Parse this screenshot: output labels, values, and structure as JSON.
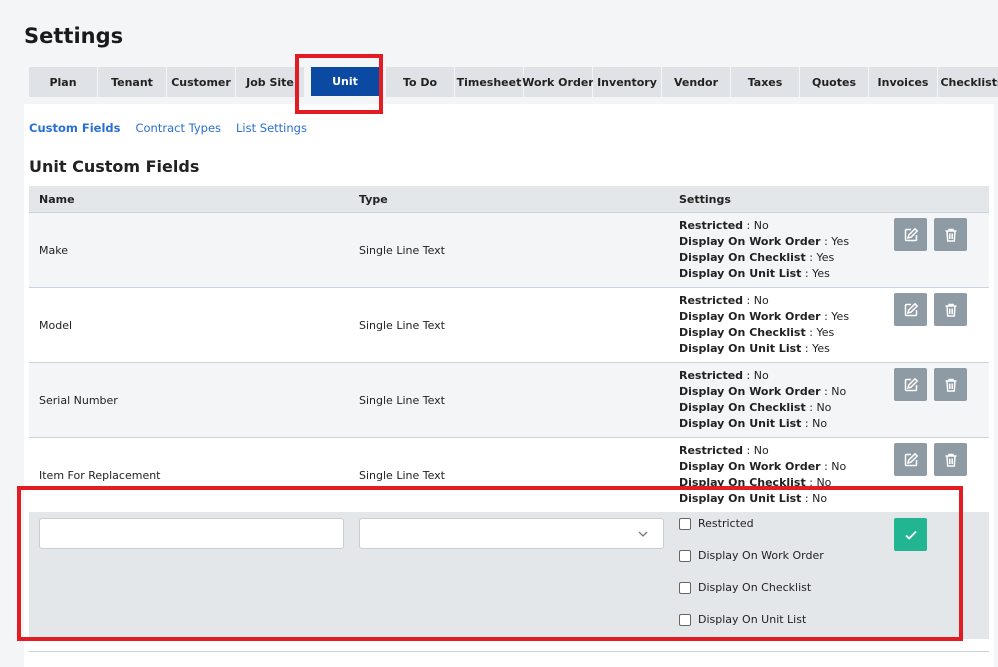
{
  "page": {
    "title": "Settings"
  },
  "tabs": [
    {
      "label": "Plan"
    },
    {
      "label": "Tenant"
    },
    {
      "label": "Customer"
    },
    {
      "label": "Job Site"
    },
    {
      "label": "Unit",
      "active": true
    },
    {
      "label": "To Do"
    },
    {
      "label": "Timesheet"
    },
    {
      "label": "Work Order"
    },
    {
      "label": "Inventory"
    },
    {
      "label": "Vendor"
    },
    {
      "label": "Taxes"
    },
    {
      "label": "Quotes"
    },
    {
      "label": "Invoices"
    },
    {
      "label": "Checklists"
    }
  ],
  "subnav": [
    {
      "label": "Custom Fields",
      "active": true
    },
    {
      "label": "Contract Types"
    },
    {
      "label": "List Settings"
    }
  ],
  "section": {
    "title": "Unit Custom Fields"
  },
  "table": {
    "headers": {
      "name": "Name",
      "type": "Type",
      "settings": "Settings"
    },
    "setting_labels": {
      "restricted": "Restricted",
      "work_order": "Display On Work Order",
      "checklist": "Display On Checklist",
      "unit_list": "Display On Unit List"
    },
    "rows": [
      {
        "name": "Make",
        "type": "Single Line Text",
        "restricted": "No",
        "work_order": "Yes",
        "checklist": "Yes",
        "unit_list": "Yes"
      },
      {
        "name": "Model",
        "type": "Single Line Text",
        "restricted": "No",
        "work_order": "Yes",
        "checklist": "Yes",
        "unit_list": "Yes"
      },
      {
        "name": "Serial Number",
        "type": "Single Line Text",
        "restricted": "No",
        "work_order": "No",
        "checklist": "No",
        "unit_list": "No"
      },
      {
        "name": "Item For Replacement",
        "type": "Single Line Text",
        "restricted": "No",
        "work_order": "No",
        "checklist": "No",
        "unit_list": "No"
      }
    ]
  },
  "new_field": {
    "name_value": "",
    "type_value": "",
    "checkboxes": [
      {
        "label": "Restricted",
        "checked": false
      },
      {
        "label": "Display On Work Order",
        "checked": false
      },
      {
        "label": "Display On Checklist",
        "checked": false
      },
      {
        "label": "Display On Unit List",
        "checked": false
      }
    ]
  },
  "icons": {
    "edit": "edit-icon",
    "delete": "trash-icon",
    "save": "check-icon",
    "dropdown": "chevron-down-icon"
  },
  "colors": {
    "active_tab": "#0b4aa2",
    "link": "#2a6fd6",
    "action_button": "#8e9aa4",
    "save_button": "#21b591",
    "highlight": "#e31b23"
  }
}
